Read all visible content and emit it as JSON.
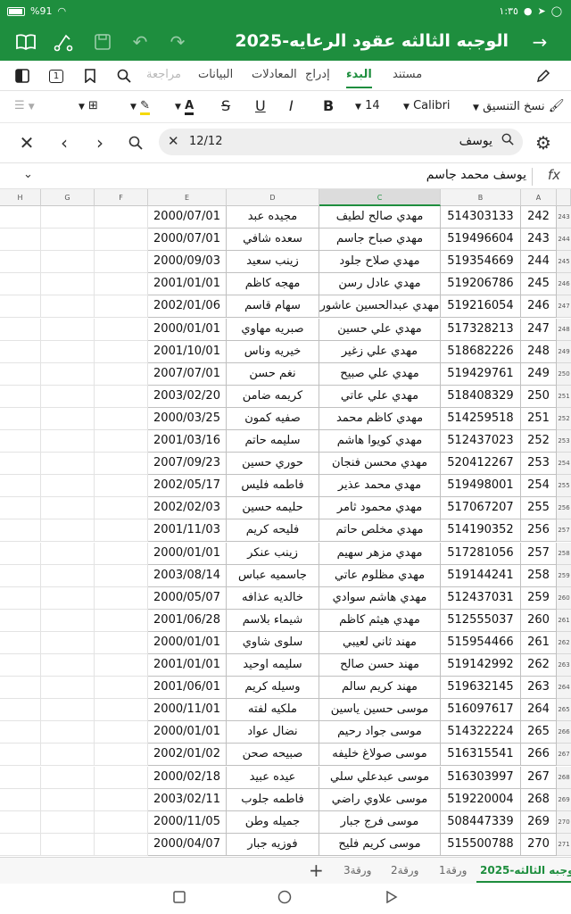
{
  "status": {
    "battery_pct": "%91",
    "time": "١:٣٥"
  },
  "title_bar": {
    "doc_title": "الوجبه الثالثه عقود الرعايه-2025"
  },
  "tabs": [
    {
      "label": "مستند"
    },
    {
      "label": "البدء"
    },
    {
      "label": "إدراج"
    },
    {
      "label": "المعادلات"
    },
    {
      "label": "البيانات"
    },
    {
      "label": "مراجعة"
    }
  ],
  "tab_page_count": "1",
  "format": {
    "font_name": "Calibri",
    "font_size": "14",
    "copy_format": "نسخ التنسيق"
  },
  "search": {
    "query": "يوسف",
    "match_count": "12/12"
  },
  "formula": {
    "value": "يوسف محمد جاسم",
    "fx": "fx"
  },
  "columns": [
    "A",
    "B",
    "C",
    "D",
    "E",
    "F",
    "G",
    "H"
  ],
  "rows": [
    {
      "rn": "243",
      "a": "242",
      "b": "514303133",
      "c": "مهدي صالح لطيف",
      "d": "مجيده عبد",
      "e": "2000/07/01"
    },
    {
      "rn": "244",
      "a": "243",
      "b": "519496604",
      "c": "مهدي صباح جاسم",
      "d": "سعده شافي",
      "e": "2000/07/01"
    },
    {
      "rn": "245",
      "a": "244",
      "b": "519354669",
      "c": "مهدي صلاح جلود",
      "d": "زينب سعيد",
      "e": "2000/09/03"
    },
    {
      "rn": "246",
      "a": "245",
      "b": "519206786",
      "c": "مهدي عادل رسن",
      "d": "مهجه كاظم",
      "e": "2001/01/01"
    },
    {
      "rn": "247",
      "a": "246",
      "b": "519216054",
      "c": "مهدي عبدالحسين عاشور",
      "d": "سهام قاسم",
      "e": "2002/01/06"
    },
    {
      "rn": "248",
      "a": "247",
      "b": "517328213",
      "c": "مهدي علي حسين",
      "d": "صبريه مهاوي",
      "e": "2000/01/01"
    },
    {
      "rn": "249",
      "a": "248",
      "b": "518682226",
      "c": "مهدي علي زغير",
      "d": "خيريه وناس",
      "e": "2001/10/01"
    },
    {
      "rn": "250",
      "a": "249",
      "b": "519429761",
      "c": "مهدي علي صبيح",
      "d": "نغم حسن",
      "e": "2007/07/01"
    },
    {
      "rn": "251",
      "a": "250",
      "b": "518408329",
      "c": "مهدي علي عاتي",
      "d": "كريمه ضامن",
      "e": "2003/02/20"
    },
    {
      "rn": "252",
      "a": "251",
      "b": "514259518",
      "c": "مهدي كاظم محمد",
      "d": "صفيه كمون",
      "e": "2000/03/25"
    },
    {
      "rn": "253",
      "a": "252",
      "b": "512437023",
      "c": "مهدي كويوا هاشم",
      "d": "سليمه حاتم",
      "e": "2001/03/16"
    },
    {
      "rn": "254",
      "a": "253",
      "b": "520412267",
      "c": "مهدي محسن فنجان",
      "d": "حوري حسين",
      "e": "2007/09/23"
    },
    {
      "rn": "255",
      "a": "254",
      "b": "519498001",
      "c": "مهدي محمد عذير",
      "d": "فاطمه فليس",
      "e": "2002/05/17"
    },
    {
      "rn": "256",
      "a": "255",
      "b": "517067207",
      "c": "مهدي محمود ثامر",
      "d": "حليمه حسين",
      "e": "2002/02/03"
    },
    {
      "rn": "257",
      "a": "256",
      "b": "514190352",
      "c": "مهدي مخلص حاتم",
      "d": "فليحه كريم",
      "e": "2001/11/03"
    },
    {
      "rn": "258",
      "a": "257",
      "b": "517281056",
      "c": "مهدي مزهر سهيم",
      "d": "زينب عنكر",
      "e": "2000/01/01"
    },
    {
      "rn": "259",
      "a": "258",
      "b": "519144241",
      "c": "مهدي مظلوم عاتي",
      "d": "جاسميه عباس",
      "e": "2003/08/14"
    },
    {
      "rn": "260",
      "a": "259",
      "b": "512437031",
      "c": "مهدي هاشم سوادي",
      "d": "خالديه عذافه",
      "e": "2000/05/07"
    },
    {
      "rn": "261",
      "a": "260",
      "b": "512555037",
      "c": "مهدي هيثم كاظم",
      "d": "شيماء بلاسم",
      "e": "2001/06/28"
    },
    {
      "rn": "262",
      "a": "261",
      "b": "515954466",
      "c": "مهند ثاني لعيبي",
      "d": "سلوى شاوي",
      "e": "2000/01/01"
    },
    {
      "rn": "263",
      "a": "262",
      "b": "519142992",
      "c": "مهند حسن صالح",
      "d": "سليمه اوحيد",
      "e": "2001/01/01"
    },
    {
      "rn": "264",
      "a": "263",
      "b": "519632145",
      "c": "مهند كريم سالم",
      "d": "وسيله كريم",
      "e": "2001/06/01"
    },
    {
      "rn": "265",
      "a": "264",
      "b": "516097617",
      "c": "موسى حسين ياسين",
      "d": "ملكيه لفته",
      "e": "2000/11/01"
    },
    {
      "rn": "266",
      "a": "265",
      "b": "514322224",
      "c": "موسى جواد رحيم",
      "d": "نضال عواد",
      "e": "2000/01/01"
    },
    {
      "rn": "267",
      "a": "266",
      "b": "516315541",
      "c": "موسى صولاغ خليفه",
      "d": "صبيحه صحن",
      "e": "2002/01/02"
    },
    {
      "rn": "268",
      "a": "267",
      "b": "516303997",
      "c": "موسى عبدعلي سلي",
      "d": "عيده عبيد",
      "e": "2000/02/18"
    },
    {
      "rn": "269",
      "a": "268",
      "b": "519220004",
      "c": "موسى علاوي راضي",
      "d": "فاطمه جلوب",
      "e": "2003/02/11"
    },
    {
      "rn": "270",
      "a": "269",
      "b": "508447339",
      "c": "موسى فرج جبار",
      "d": "جميله وطن",
      "e": "2000/11/05"
    },
    {
      "rn": "271",
      "a": "270",
      "b": "515500788",
      "c": "موسى كريم فليح",
      "d": "فوزيه جبار",
      "e": "2000/04/07"
    }
  ],
  "sheet_tabs": [
    {
      "label": "الوجبه الثالثه-2025"
    },
    {
      "label": "ورقة1"
    },
    {
      "label": "ورقة2"
    },
    {
      "label": "ورقة3"
    }
  ]
}
